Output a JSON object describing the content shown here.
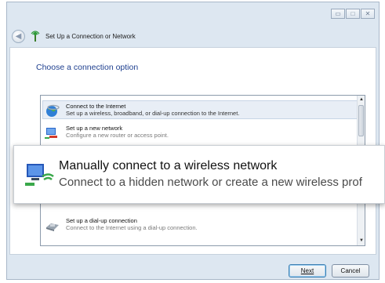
{
  "window": {
    "title": "Set Up a Connection or Network",
    "caption_buttons": [
      "minimize",
      "maximize",
      "close"
    ]
  },
  "heading": "Choose a connection option",
  "options": [
    {
      "title": "Connect to the Internet",
      "desc": "Set up a wireless, broadband, or dial-up connection to the Internet.",
      "icon": "globe-icon",
      "selected": true
    },
    {
      "title": "Set up a new network",
      "desc": "Configure a new router or access point.",
      "icon": "network-icon",
      "selected": false
    },
    {
      "title": "Set up a dial-up connection",
      "desc": "Connect to the Internet using a dial-up connection.",
      "icon": "phone-icon",
      "selected": false
    }
  ],
  "zoom": {
    "title": "Manually connect to a wireless network",
    "desc": "Connect to a hidden network or create a new wireless prof",
    "icon": "wireless-computer-icon"
  },
  "buttons": {
    "next": "Next",
    "cancel": "Cancel"
  },
  "colors": {
    "heading": "#1e3f8f",
    "window_frame": "#dde7f1",
    "selection": "#e8eef6"
  }
}
